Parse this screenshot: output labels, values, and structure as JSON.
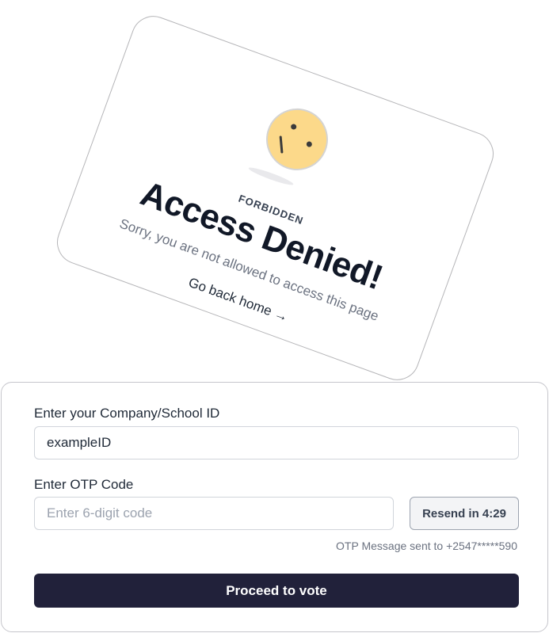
{
  "forbidden_card": {
    "eyebrow": "FORBIDDEN",
    "heading": "Access Denied!",
    "message": "Sorry, you are not allowed to access this page",
    "back_link": "Go back home →",
    "emoji_icon": "confused-face-icon"
  },
  "form": {
    "company_label": "Enter your Company/School ID",
    "company_value": "exampleID",
    "otp_label": "Enter OTP Code",
    "otp_placeholder": "Enter 6-digit code",
    "otp_value": "",
    "resend_label": "Resend in 4:29",
    "otp_status": "OTP Message sent to +2547*****590",
    "proceed_label": "Proceed to vote"
  },
  "colors": {
    "primary_button": "#21213a",
    "emoji_face": "#fcd98a"
  }
}
